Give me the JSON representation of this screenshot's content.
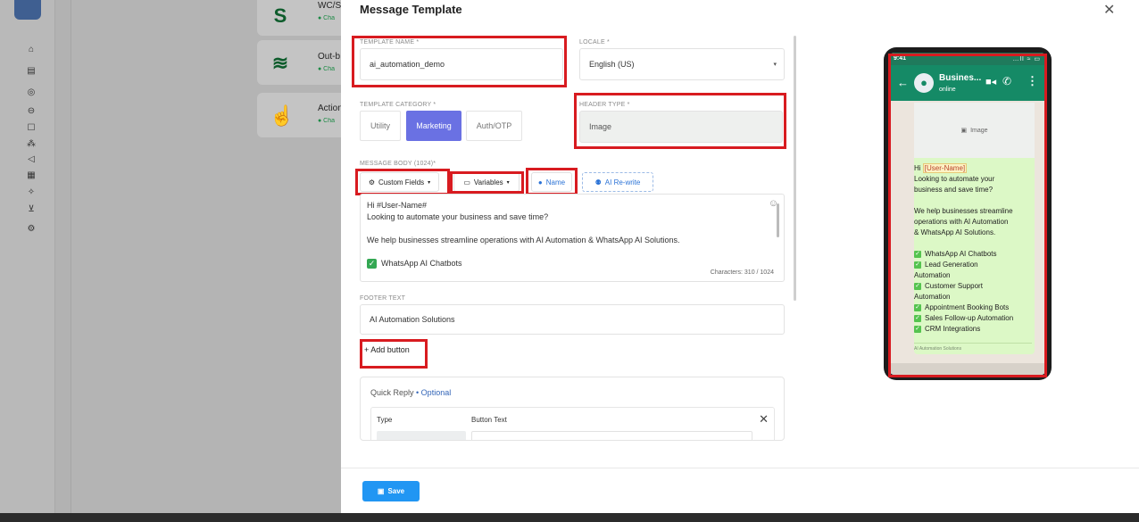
{
  "background": {
    "cards": [
      {
        "title": "WC/S",
        "status": "● Cha"
      },
      {
        "title": "Out-b",
        "status": "● Cha"
      },
      {
        "title": "Action",
        "status": "● Cha"
      }
    ]
  },
  "modal": {
    "title": "Message Template",
    "close_icon": "close-icon",
    "template_name": {
      "label": "TEMPLATE NAME *",
      "value": "ai_automation_demo"
    },
    "locale": {
      "label": "LOCALE *",
      "value": "English (US)"
    },
    "template_category": {
      "label": "TEMPLATE CATEGORY *",
      "options": [
        "Utility",
        "Marketing",
        "Auth/OTP"
      ],
      "selected": "Marketing"
    },
    "header_type": {
      "label": "HEADER TYPE *",
      "value": "Image"
    },
    "message_body": {
      "label": "MESSAGE BODY (1024)*",
      "buttons": {
        "custom_fields": "Custom Fields",
        "variables": "Variables",
        "name": "Name",
        "ai_rewrite": "AI Re-write"
      },
      "lines": [
        "Hi  #User-Name#",
        "Looking to automate your business and save time?",
        "",
        "We help businesses streamline operations with AI Automation & WhatsApp AI Solutions.",
        "",
        "WhatsApp AI Chatbots"
      ],
      "char_count": "Characters: 310 / 1024"
    },
    "footer_text": {
      "label": "FOOTER TEXT",
      "value": "AI Automation Solutions"
    },
    "add_button": "+ Add button",
    "quick_reply": {
      "title": "Quick Reply",
      "optional": "• Optional",
      "col_type": "Type",
      "col_button_text": "Button Text"
    },
    "save_label": "Save"
  },
  "preview": {
    "time": "9:41",
    "status_icons": "…ll ≈ ▭",
    "business_name": "Busines...",
    "status": "online",
    "image_label": "Image",
    "greeting": "Hi",
    "user_tag": "[User-Name]",
    "body_lines": [
      "Looking to automate your",
      "business and save time?",
      "",
      "We help businesses streamline",
      "operations with AI Automation",
      "& WhatsApp AI Solutions.",
      ""
    ],
    "check_items": [
      "WhatsApp AI Chatbots",
      "Lead Generation",
      "Automation",
      "Customer Support",
      "Automation",
      "Appointment Booking Bots",
      "Sales Follow-up Automation",
      "CRM Integrations"
    ],
    "footer": "AI Automation Solutions"
  },
  "colors": {
    "accent": "#6a71e3",
    "save_button": "#2196f3",
    "whatsapp_header": "#158a66",
    "bubble": "#dcf8c6",
    "highlight_box": "#d81b20"
  }
}
